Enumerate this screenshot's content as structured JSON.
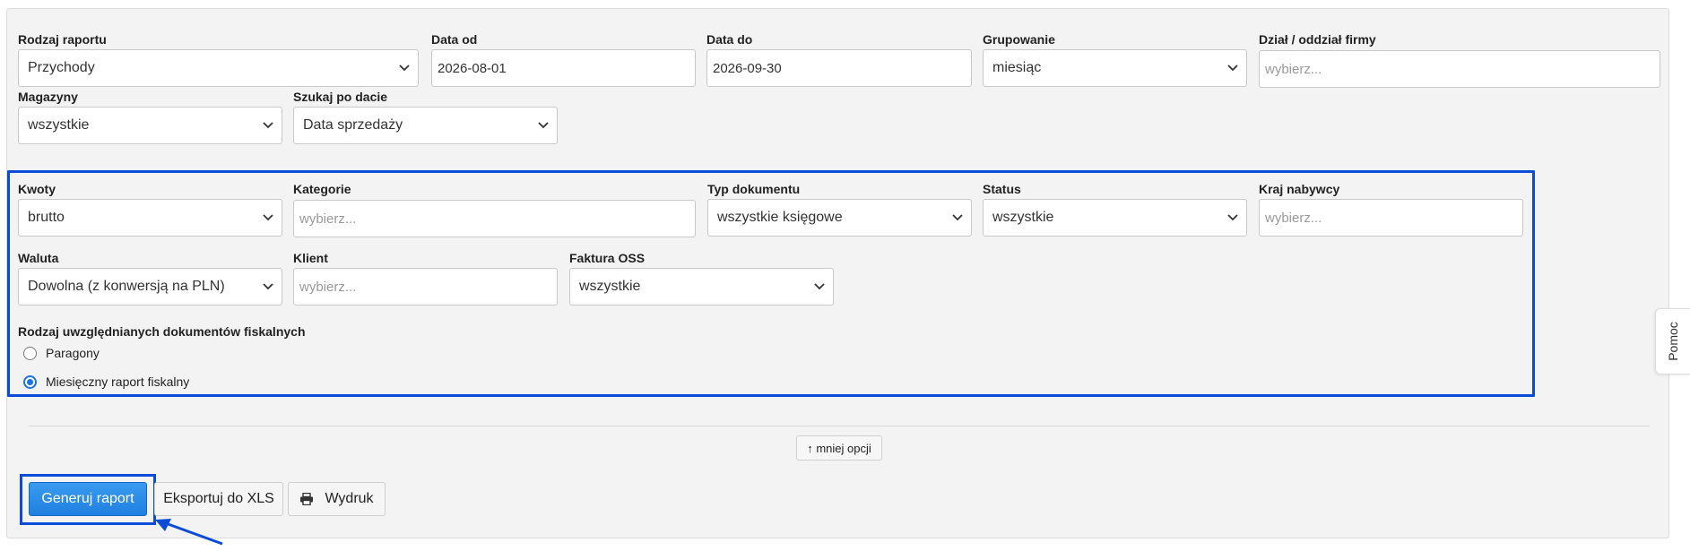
{
  "row1": [
    {
      "key": "rodzaj-raportu",
      "label": "Rodzaj raportu",
      "value": "Przychody",
      "kind": "select"
    },
    {
      "key": "data-od",
      "label": "Data od",
      "value": "2026-08-01",
      "kind": "input"
    },
    {
      "key": "data-do",
      "label": "Data do",
      "value": "2026-09-30",
      "kind": "input"
    },
    {
      "key": "grupowanie",
      "label": "Grupowanie",
      "value": "miesiąc",
      "kind": "select"
    },
    {
      "key": "dzial",
      "label": "Dział / oddział firmy",
      "placeholder": "wybierz...",
      "kind": "input"
    }
  ],
  "row2": [
    {
      "key": "magazyny",
      "label": "Magazyny",
      "value": "wszystkie",
      "kind": "select"
    },
    {
      "key": "szukaj-po-dacie",
      "label": "Szukaj po dacie",
      "value": "Data sprzedaży",
      "kind": "select"
    }
  ],
  "row3": [
    {
      "key": "kwoty",
      "label": "Kwoty",
      "value": "brutto",
      "kind": "select"
    },
    {
      "key": "kategorie",
      "label": "Kategorie",
      "placeholder": "wybierz...",
      "kind": "input"
    },
    {
      "key": "typ-dokumentu",
      "label": "Typ dokumentu",
      "value": "wszystkie księgowe",
      "kind": "select"
    },
    {
      "key": "status",
      "label": "Status",
      "value": "wszystkie",
      "kind": "select"
    },
    {
      "key": "kraj-nabywcy",
      "label": "Kraj nabywcy",
      "placeholder": "wybierz...",
      "kind": "input"
    }
  ],
  "row4": [
    {
      "key": "waluta",
      "label": "Waluta",
      "value": "Dowolna (z konwersją na PLN)",
      "kind": "select"
    },
    {
      "key": "klient",
      "label": "Klient",
      "placeholder": "wybierz...",
      "kind": "input"
    },
    {
      "key": "faktura-oss",
      "label": "Faktura OSS",
      "value": "wszystkie",
      "kind": "select"
    }
  ],
  "fiscal": {
    "label": "Rodzaj uwzględnianych dokumentów fiskalnych",
    "options": [
      {
        "label": "Paragony",
        "checked": false
      },
      {
        "label": "Miesięczny raport fiskalny",
        "checked": true
      }
    ]
  },
  "less_options_label": "↑ mniej opcji",
  "buttons": {
    "generate": "Generuj raport",
    "export_xls": "Eksportuj do XLS",
    "print": "Wydruk"
  },
  "help_tab": "Pomoc",
  "colors": {
    "highlight": "#0a4bd8",
    "primary": "#1f7fe0",
    "panel": "#f3f3f3"
  },
  "icons": {
    "select": "chevron-down-icon",
    "print": "printer-icon",
    "annotation": "arrow-icon"
  }
}
